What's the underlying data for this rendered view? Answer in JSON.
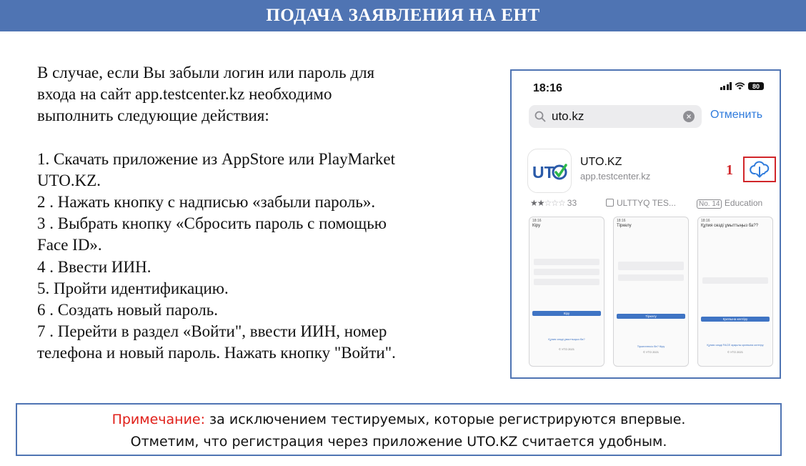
{
  "header": {
    "title": "ПОДАЧА ЗАЯВЛЕНИЯ НА ЕНТ"
  },
  "instructions": {
    "intro": [
      "В случае, если Вы забыли логин или пароль для",
      "входа на сайт app.testcenter.kz необходимо",
      "выполнить следующие действия:"
    ],
    "steps": [
      "1. Скачать приложение из AppStore или PlayMarket",
      "UTO.KZ.",
      "2 . Нажать кнопку с надписью «забыли пароль».",
      "3 . Выбрать кнопку «Сбросить пароль с помощью",
      "Face ID».",
      "4 . Ввести ИИН.",
      "5. Пройти идентификацию.",
      "6 . Создать новый пароль.",
      "7 . Перейти в раздел «Войти\", ввести ИИН, номер",
      "телефона и новый пароль. Нажать кнопку \"Войти\"."
    ]
  },
  "phone": {
    "status_time": "18:16",
    "battery": "80",
    "search_query": "uto.kz",
    "cancel_label": "Отменить",
    "app": {
      "name": "UTO.KZ",
      "url": "app.testcenter.kz",
      "logo_text": "UT",
      "rating_count": "33",
      "rating_stars": 2,
      "developer": "ULTTYQ TES...",
      "rank": "No. 14",
      "category": "Education"
    },
    "step_marker": "1",
    "screenshots": [
      {
        "title": "Кіру",
        "button": "Кіру",
        "link": "Құпия сөзді ұмыттыңыз ба?",
        "copy": "© УТО 2021"
      },
      {
        "title": "Тіркелу",
        "button": "Тіркелу",
        "link": "Тіркелгенсіз бе? Кіру",
        "copy": "© УТО 2021"
      },
      {
        "title": "Құпия сөзді ұмыттыңыз ба??",
        "button": "Қалпына келтіру",
        "link": "Құпия сөзді FACE арқылы қалпына келтіру",
        "copy": "© УТО 2021"
      }
    ]
  },
  "note": {
    "label": "Примечание:",
    "line1": " за исключением тестируемых, которые регистрируются впервые.",
    "line2": "Отметим, что регистрация через приложение UTO.KZ считается удобным."
  },
  "colors": {
    "header_bg": "#4f74b3",
    "accent_red": "#d1262a",
    "link_blue": "#2f7bdc",
    "logo_green": "#2db84a",
    "logo_blue": "#2a5aa8"
  }
}
